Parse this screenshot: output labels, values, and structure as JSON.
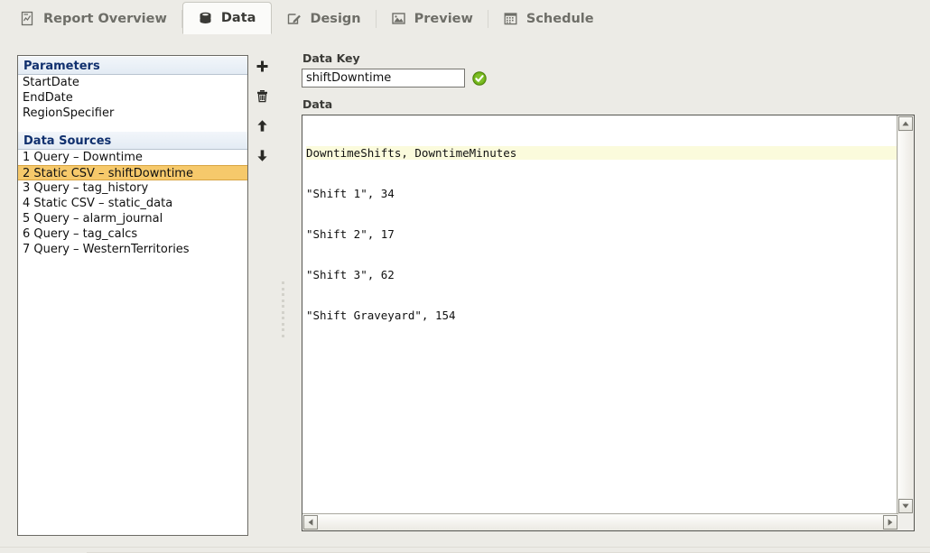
{
  "tabs": [
    {
      "label": "Report Overview",
      "icon": "report-overview-icon",
      "active": false
    },
    {
      "label": "Data",
      "icon": "database-icon",
      "active": true
    },
    {
      "label": "Design",
      "icon": "pencil-edit-icon",
      "active": false
    },
    {
      "label": "Preview",
      "icon": "image-preview-icon",
      "active": false
    },
    {
      "label": "Schedule",
      "icon": "calendar-icon",
      "active": false
    }
  ],
  "left_panel": {
    "parameters_header": "Parameters",
    "parameters": [
      {
        "label": "StartDate"
      },
      {
        "label": "EndDate"
      },
      {
        "label": "RegionSpecifier"
      }
    ],
    "data_sources_header": "Data Sources",
    "data_sources": [
      {
        "label": "1 Query – Downtime",
        "selected": false
      },
      {
        "label": "2 Static CSV – shiftDowntime",
        "selected": true
      },
      {
        "label": "3 Query – tag_history",
        "selected": false
      },
      {
        "label": "4 Static CSV – static_data",
        "selected": false
      },
      {
        "label": "5 Query – alarm_journal",
        "selected": false
      },
      {
        "label": "6 Query – tag_calcs",
        "selected": false
      },
      {
        "label": "7 Query – WesternTerritories",
        "selected": false
      }
    ]
  },
  "toolbar": {
    "add_label": "Add data source",
    "delete_label": "Delete data source",
    "move_up_label": "Move up",
    "move_down_label": "Move down",
    "icons": [
      "plus-icon",
      "trash-icon",
      "arrow-up-icon",
      "arrow-down-icon"
    ]
  },
  "right_pane": {
    "data_key_label": "Data Key",
    "data_key_value": "shiftDowntime",
    "data_key_placeholder": "",
    "valid_icon": "green-check-icon",
    "data_label": "Data",
    "csv_header_line": "DowntimeShifts, DowntimeMinutes",
    "csv_rows": [
      "\"Shift 1\", 34",
      "\"Shift 2\", 17",
      "\"Shift 3\", 62",
      "\"Shift Graveyard\", 154"
    ]
  },
  "scrollbars": {
    "vertical_up_icon": "scroll-up-icon",
    "vertical_down_icon": "scroll-down-icon",
    "horizontal_left_icon": "scroll-left-icon",
    "horizontal_right_icon": "scroll-right-icon"
  },
  "colors": {
    "window_bg": "#ecebe6",
    "selection": "#f6c96b",
    "section_header_text": "#10306e",
    "valid_green": "#49a11a",
    "csv_header_highlight": "#fbfbdc"
  }
}
